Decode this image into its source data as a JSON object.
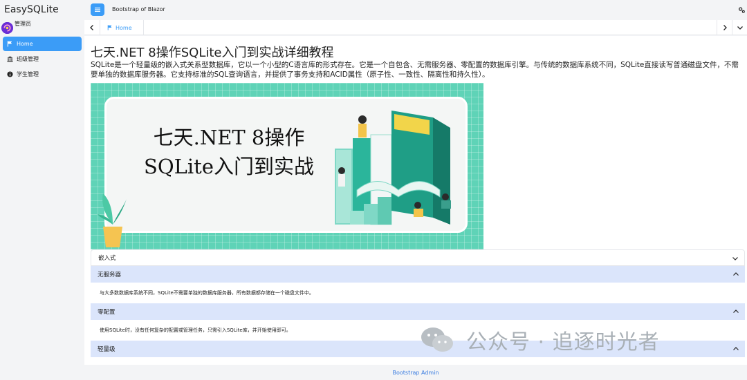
{
  "sidebar": {
    "brand": "EasySQLite",
    "user_name": "管理员",
    "items": [
      {
        "label": "Home",
        "icon": "flag-icon",
        "active": true
      },
      {
        "label": "班级管理",
        "icon": "building-icon",
        "active": false
      },
      {
        "label": "学生管理",
        "icon": "info-circle-icon",
        "active": false
      }
    ]
  },
  "topbar": {
    "title": "Bootstrap of Blazor"
  },
  "tabs": {
    "items": [
      {
        "label": "Home",
        "icon": "flag-icon"
      }
    ]
  },
  "content": {
    "title": "七天.NET 8操作SQLite入门到实战详细教程",
    "intro": "SQLite是一个轻量级的嵌入式关系型数据库，它以一个小型的C语言库的形式存在。它是一个自包含、无需服务器、零配置的数据库引擎。与传统的数据库系统不同，SQLite直接读写普通磁盘文件，不需要单独的数据库服务器。它支持标准的SQL查询语言，并提供了事务支持和ACID属性（原子性、一致性、隔离性和持久性）。",
    "banner_line1": "七天.NET 8操作",
    "banner_line2": "SQLite入门到实战"
  },
  "accordion": [
    {
      "title": "嵌入式",
      "state": "collapsed",
      "body": ""
    },
    {
      "title": "无服务器",
      "state": "open",
      "body": "与大多数数据库系统不同，SQLite不需要单独的数据库服务器，所有数据都存储在一个磁盘文件中。"
    },
    {
      "title": "零配置",
      "state": "open",
      "body": "使用SQLite时，没有任何复杂的配置或管理任务，只需引入SQLite库，并开始使用即可。"
    },
    {
      "title": "轻量级",
      "state": "open",
      "body": ""
    }
  ],
  "watermark": "公众号 · 追逐时光者",
  "footer": "Bootstrap Admin",
  "colors": {
    "accent": "#3b9cf7",
    "accordion_open": "#dbe5fb",
    "banner": "#5fd3b7"
  }
}
